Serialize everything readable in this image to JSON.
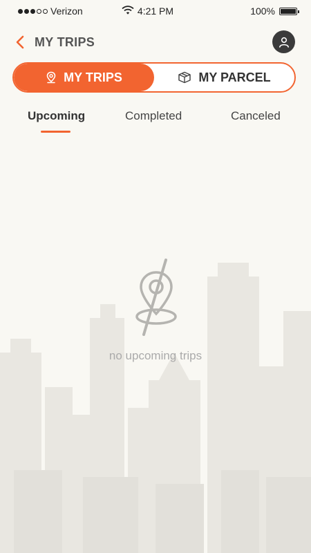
{
  "status_bar": {
    "carrier": "Verizon",
    "time": "4:21 PM",
    "battery": "100%"
  },
  "header": {
    "title": "MY TRIPS",
    "back_icon": "chevron-left-icon",
    "avatar_icon": "user-icon"
  },
  "segmented": {
    "trips_label": "MY TRIPS",
    "parcel_label": "MY PARCEL",
    "active": "trips"
  },
  "tabs": [
    {
      "label": "Upcoming",
      "active": true
    },
    {
      "label": "Completed",
      "active": false
    },
    {
      "label": "Canceled",
      "active": false
    }
  ],
  "empty_state": {
    "icon": "no-location-icon",
    "message": "no upcoming trips"
  },
  "colors": {
    "accent": "#f26430",
    "background": "#f9f8f3"
  }
}
